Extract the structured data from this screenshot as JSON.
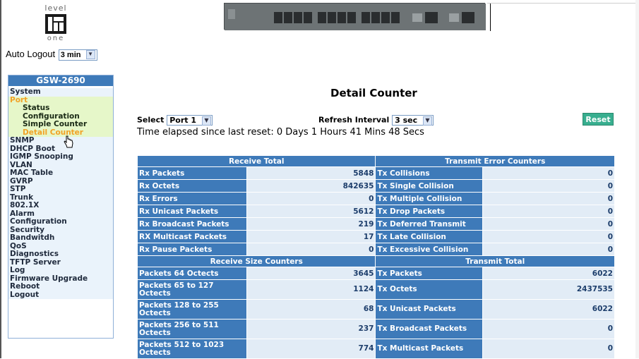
{
  "logo": {
    "top": "level",
    "bottom": "one"
  },
  "auto_logout": {
    "label": "Auto Logout",
    "value": "3 min"
  },
  "menu": {
    "title": "GSW-2690",
    "items": [
      {
        "label": "System",
        "kind": "top"
      },
      {
        "label": "Port",
        "kind": "port"
      },
      {
        "label": "Status",
        "kind": "sub"
      },
      {
        "label": "Configuration",
        "kind": "sub"
      },
      {
        "label": "Simple Counter",
        "kind": "sub"
      },
      {
        "label": "Detail Counter",
        "kind": "sub-active"
      },
      {
        "label": "SNMP",
        "kind": "top"
      },
      {
        "label": "DHCP Boot",
        "kind": "top"
      },
      {
        "label": "IGMP Snooping",
        "kind": "top"
      },
      {
        "label": "VLAN",
        "kind": "top"
      },
      {
        "label": "MAC Table",
        "kind": "top"
      },
      {
        "label": "GVRP",
        "kind": "top"
      },
      {
        "label": "STP",
        "kind": "top"
      },
      {
        "label": "Trunk",
        "kind": "top"
      },
      {
        "label": "802.1X",
        "kind": "top"
      },
      {
        "label": "Alarm",
        "kind": "top"
      },
      {
        "label": "Configuration",
        "kind": "top"
      },
      {
        "label": "Security",
        "kind": "top"
      },
      {
        "label": "Bandwitdh",
        "kind": "top"
      },
      {
        "label": "QoS",
        "kind": "top"
      },
      {
        "label": "Diagnostics",
        "kind": "top"
      },
      {
        "label": "TFTP Server",
        "kind": "top"
      },
      {
        "label": "Log",
        "kind": "top"
      },
      {
        "label": "Firmware Upgrade",
        "kind": "top"
      },
      {
        "label": "Reboot",
        "kind": "top"
      },
      {
        "label": "Logout",
        "kind": "top"
      }
    ]
  },
  "main": {
    "title": "Detail Counter",
    "select_label": "Select",
    "select_value": "Port 1",
    "refresh_label": "Refresh Interval",
    "refresh_value": "3 sec",
    "reset_label": "Reset",
    "elapsed": "Time elapsed since last reset: 0 Days 1 Hours 41 Mins 48 Secs"
  },
  "tables": {
    "receive_total_header": "Receive Total",
    "transmit_error_header": "Transmit Error Counters",
    "receive_size_header": "Receive Size Counters",
    "transmit_total_header": "Transmit Total",
    "section1": [
      {
        "rx": "Rx Packets",
        "rxv": "5848",
        "tx": "Tx Collisions",
        "txv": "0"
      },
      {
        "rx": "Rx Octets",
        "rxv": "842635",
        "tx": "Tx Single Collision",
        "txv": "0"
      },
      {
        "rx": "Rx Errors",
        "rxv": "0",
        "tx": "Tx Multiple Collision",
        "txv": "0"
      },
      {
        "rx": "Rx Unicast Packets",
        "rxv": "5612",
        "tx": "Tx Drop Packets",
        "txv": "0"
      },
      {
        "rx": "Rx Broadcast Packets",
        "rxv": "219",
        "tx": "Tx Deferred Transmit",
        "txv": "0"
      },
      {
        "rx": "RX Multicast Packets",
        "rxv": "17",
        "tx": "Tx Late Collision",
        "txv": "0"
      },
      {
        "rx": "Rx Pause Packets",
        "rxv": "0",
        "tx": "Tx Excessive Collision",
        "txv": "0"
      }
    ],
    "section2": [
      {
        "rx": "Packets 64 Octects",
        "rxv": "3645",
        "tx": "Tx Packets",
        "txv": "6022"
      },
      {
        "rx": "Packets 65 to 127 Octects",
        "rxv": "1124",
        "tx": "Tx Octets",
        "txv": "2437535"
      },
      {
        "rx": "Packets 128 to 255 Octects",
        "rxv": "68",
        "tx": "Tx Unicast Packets",
        "txv": "6022"
      },
      {
        "rx": "Packets 256 to 511 Octects",
        "rxv": "237",
        "tx": "Tx Broadcast Packets",
        "txv": "0"
      },
      {
        "rx": "Packets 512 to 1023 Octects",
        "rxv": "774",
        "tx": "Tx Multicast Packets",
        "txv": "0"
      }
    ]
  },
  "colors": {
    "header_blue": "#3e7ab9",
    "value_bg": "#e2ecf6",
    "reset_green": "#38ae8f",
    "active_orange": "#f2a226"
  }
}
